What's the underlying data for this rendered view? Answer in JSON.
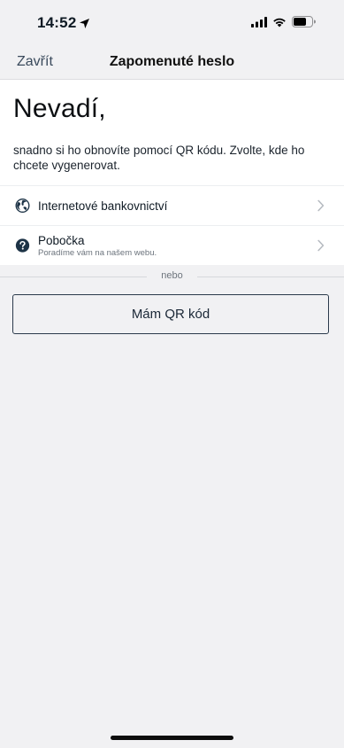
{
  "status_bar": {
    "time": "14:52"
  },
  "nav": {
    "close_label": "Zavřít",
    "title": "Zapomenuté heslo"
  },
  "header": {
    "headline": "Nevadí,",
    "description": "snadno si ho obnovíte pomocí QR kódu. Zvolte, kde ho chcete vygenerovat."
  },
  "options": [
    {
      "title": "Internetové bankovnictví",
      "subtitle": "",
      "icon": "globe-icon"
    },
    {
      "title": "Pobočka",
      "subtitle": "Poradíme vám na našem webu.",
      "icon": "question-circle-icon"
    }
  ],
  "separator": {
    "label": "nebo"
  },
  "qr_button": {
    "label": "Mám QR kód"
  },
  "colors": {
    "background": "#f1f1f3",
    "button_border": "#2b3a4b",
    "icon": "#1d3346"
  }
}
